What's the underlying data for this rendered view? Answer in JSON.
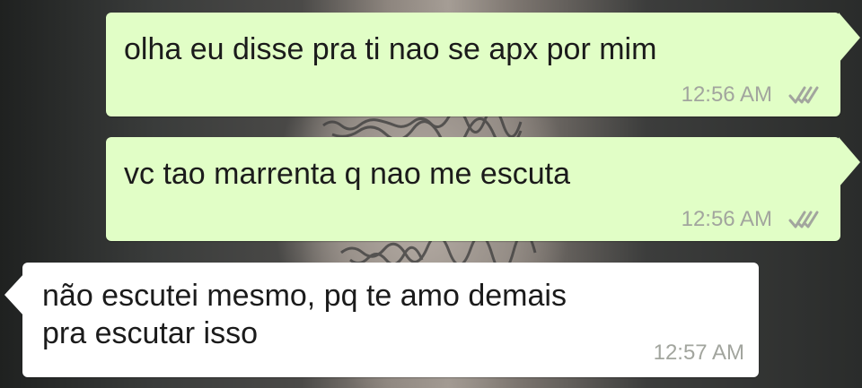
{
  "colors": {
    "outgoing_bubble": "#e1fec6",
    "incoming_bubble": "#ffffff",
    "timestamp": "#a2a59e",
    "read_ticks": "#a2a59e"
  },
  "messages": [
    {
      "direction": "outgoing",
      "text": "olha eu disse pra ti nao se apx por mim",
      "time": "12:56 AM",
      "status_icon": "double-check-icon"
    },
    {
      "direction": "outgoing",
      "text": "vc tao marrenta q nao me escuta",
      "time": "12:56 AM",
      "status_icon": "double-check-icon"
    },
    {
      "direction": "incoming",
      "text": "não escutei mesmo, pq te amo demais\npra escutar isso",
      "time": "12:57 AM"
    }
  ]
}
